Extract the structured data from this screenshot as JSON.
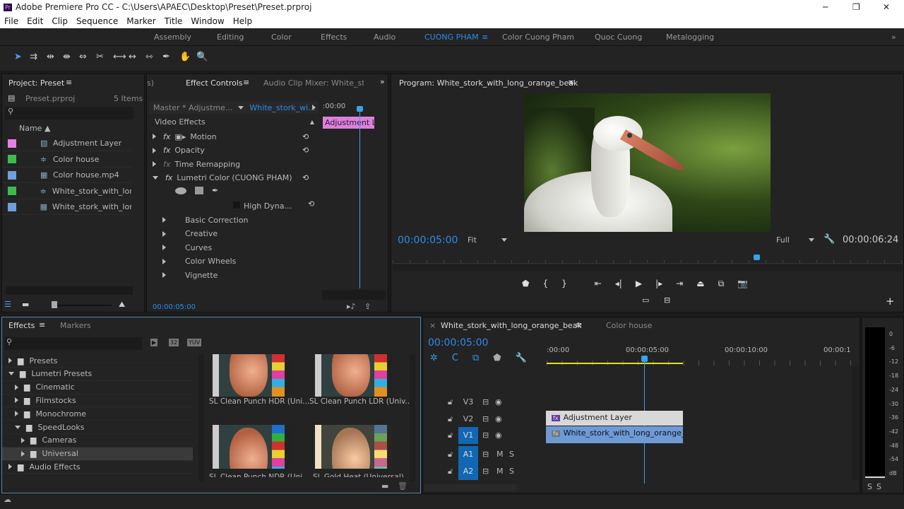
{
  "app": {
    "title": "Adobe Premiere Pro CC - C:\\Users\\APAEC\\Desktop\\Preset\\Preset.prproj",
    "logo": "Pr"
  },
  "menu": [
    "File",
    "Edit",
    "Clip",
    "Sequence",
    "Marker",
    "Title",
    "Window",
    "Help"
  ],
  "workspaces": [
    "Assembly",
    "Editing",
    "Color",
    "Effects",
    "Audio",
    "CUONG PHAM",
    "Color Cuong Pham",
    "Quoc Cuong",
    "Metalogging"
  ],
  "active_workspace": "CUONG PHAM",
  "project": {
    "title": "Project: Preset",
    "file": "Preset.prproj",
    "count": "5 Items",
    "column": "Name",
    "items": [
      {
        "name": "Adjustment Layer",
        "color": "#e67fe6"
      },
      {
        "name": "Color house",
        "color": "#3dbb4d"
      },
      {
        "name": "Color house.mp4",
        "color": "#6f9fdc"
      },
      {
        "name": "White_stork_with_lon",
        "color": "#3dbb4d"
      },
      {
        "name": "White_stork_with_lon",
        "color": "#6f9fdc"
      }
    ]
  },
  "effect_controls": {
    "prev_tab": "s)",
    "title": "Effect Controls",
    "other_tab": "Audio Clip Mixer: White_stork",
    "master": "Master * Adjustme...",
    "clip": "White_stork_wi...",
    "time_start": ":00:00",
    "clip_label": "Adjustment La",
    "section": "Video Effects",
    "effects": [
      "Motion",
      "Opacity",
      "Time Remapping",
      "Lumetri Color (CUONG PHAM)"
    ],
    "hdr": "High Dyna...",
    "subsections": [
      "Basic Correction",
      "Creative",
      "Curves",
      "Color Wheels",
      "Vignette"
    ],
    "timecode": "00:00:05:00"
  },
  "program": {
    "title": "Program: White_stork_with_long_orange_beak",
    "timecode": "00:00:05:00",
    "fit": "Fit",
    "quality": "Full",
    "duration": "00:00:06:24"
  },
  "effects_panel": {
    "tab": "Effects",
    "tab2": "Markers",
    "badges": [
      "32",
      "YUV"
    ],
    "tree": [
      {
        "label": "Presets",
        "level": 0,
        "open": false
      },
      {
        "label": "Lumetri Presets",
        "level": 0,
        "open": true
      },
      {
        "label": "Cinematic",
        "level": 1,
        "open": false
      },
      {
        "label": "Filmstocks",
        "level": 1,
        "open": false
      },
      {
        "label": "Monochrome",
        "level": 1,
        "open": false
      },
      {
        "label": "SpeedLooks",
        "level": 1,
        "open": true
      },
      {
        "label": "Cameras",
        "level": 2,
        "open": false
      },
      {
        "label": "Universal",
        "level": 2,
        "open": false,
        "selected": true
      },
      {
        "label": "Audio Effects",
        "level": 0,
        "open": false
      }
    ],
    "presets": [
      "SL Clean Punch HDR (Uni...",
      "SL Clean Punch LDR (Univ...",
      "SL Clean Punch NDR (Uni...",
      "SL Gold Heat (Universal)"
    ]
  },
  "timeline": {
    "tab": "White_stork_with_long_orange_beak",
    "tab2": "Color house",
    "timecode": "00:00:05:00",
    "ruler": [
      ":00:00",
      "00:00:05:00",
      "00:00:10:00",
      "00:00:1"
    ],
    "tracks": [
      {
        "name": "V3"
      },
      {
        "name": "V2"
      },
      {
        "name": "V1",
        "active": true
      },
      {
        "name": "A1",
        "active": true,
        "audio": true
      },
      {
        "name": "A2",
        "active": true,
        "audio": true
      }
    ],
    "clips": [
      {
        "label": "Adjustment Layer",
        "track": "V2"
      },
      {
        "label": "White_stork_with_long_orange_be",
        "track": "V1"
      }
    ],
    "mute": "M",
    "solo": "S"
  },
  "meter": {
    "scale": [
      "0",
      "-6",
      "-12",
      "-18",
      "-24",
      "-30",
      "-36",
      "-42",
      "-48",
      "-54",
      "dB"
    ],
    "solo": [
      "S",
      "S"
    ]
  },
  "colors": {
    "accent": "#2d8ceb",
    "panel": "#232323"
  }
}
